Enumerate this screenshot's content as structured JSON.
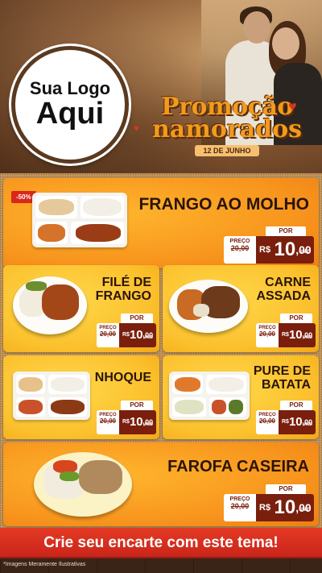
{
  "header": {
    "logo_line1": "Sua Logo",
    "logo_line2": "Aqui",
    "promo_line1": "Promoção",
    "promo_line2": "namorados",
    "promo_date": "12 DE JUNHO"
  },
  "items": [
    {
      "name": "FRANGO AO MOLHO",
      "badge": "-50%",
      "por": "POR",
      "preco": "PREÇO",
      "de": "de",
      "old_price": "20,00",
      "currency": "R$",
      "price_int": "10",
      "price_cents": ",00",
      "unid": "UNID"
    },
    {
      "name_line1": "FILÉ DE",
      "name_line2": "FRANGO",
      "por": "POR",
      "preco": "PREÇO",
      "de": "de",
      "old_price": "20,00",
      "currency": "R$",
      "price_int": "10",
      "price_cents": ",00",
      "unid": "UNID"
    },
    {
      "name_line1": "CARNE",
      "name_line2": "ASSADA",
      "por": "POR",
      "preco": "PREÇO",
      "de": "de",
      "old_price": "20,00",
      "currency": "R$",
      "price_int": "10",
      "price_cents": ",00",
      "unid": "UNID"
    },
    {
      "name": "NHOQUE",
      "por": "POR",
      "preco": "PREÇO",
      "de": "de",
      "old_price": "20,00",
      "currency": "R$",
      "price_int": "10",
      "price_cents": ",00",
      "unid": "UNID"
    },
    {
      "name_line1": "PURE DE",
      "name_line2": "BATATA",
      "por": "POR",
      "preco": "PREÇO",
      "de": "de",
      "old_price": "20,00",
      "currency": "R$",
      "price_int": "10",
      "price_cents": ",00",
      "unid": "UNID"
    },
    {
      "name": "FAROFA CASEIRA",
      "por": "POR",
      "preco": "PREÇO",
      "de": "de",
      "old_price": "20,00",
      "currency": "R$",
      "price_int": "10",
      "price_cents": ",00",
      "unid": "UNID"
    }
  ],
  "cta": "Crie seu encarte com este tema!",
  "disclaimer": "*Imagens Meramente Ilustrativas",
  "colors": {
    "orange": "#f7941d",
    "yellow": "#fbc02d",
    "price_red": "#7a1f0d",
    "cta_red": "#d8281a"
  }
}
